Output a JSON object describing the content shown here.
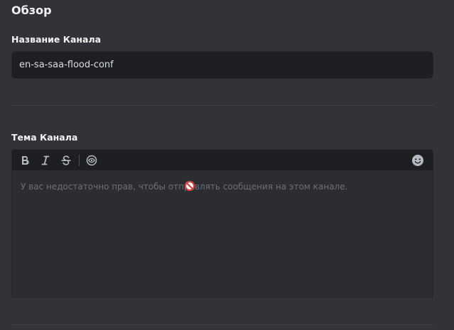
{
  "page": {
    "title": "Обзор"
  },
  "channel_name": {
    "label": "Название Канала",
    "value": "en-sa-saa-flood-conf"
  },
  "channel_topic": {
    "label": "Тема Канала",
    "placeholder": "У вас недостаточно прав, чтобы отправлять сообщения на этом канале.",
    "toolbar": [
      {
        "name": "bold",
        "icon": "bold-icon"
      },
      {
        "name": "italic",
        "icon": "italic-icon"
      },
      {
        "name": "strikethrough",
        "icon": "strikethrough-icon"
      },
      {
        "name": "spoiler",
        "icon": "eye-icon"
      },
      {
        "name": "emoji",
        "icon": "emoji-face-icon"
      }
    ]
  },
  "colors": {
    "background": "#313338",
    "input_background": "#1e1f22",
    "editor_background": "#2b2d31",
    "text_primary": "#f2f3f5",
    "text_muted": "#6d6f78",
    "icon_color": "#b5bac1"
  }
}
